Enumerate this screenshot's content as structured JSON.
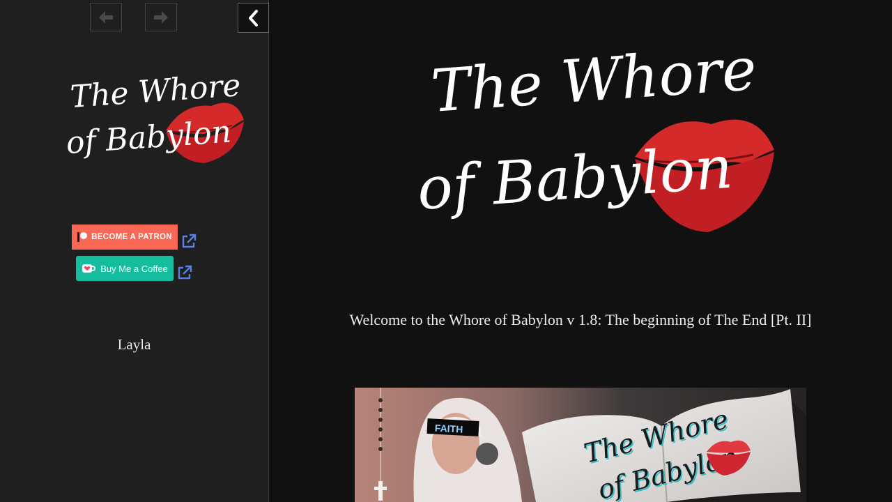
{
  "nav": {
    "back_icon": "arrow-left-icon",
    "forward_icon": "arrow-right-icon",
    "collapse_icon": "chevron-left-icon"
  },
  "sidebar": {
    "logo_text_line1": "The Whore",
    "logo_text_line2": "of Babylon",
    "patron_label": "BECOME A PATRON",
    "coffee_label": "Buy Me a Coffee",
    "external_link_icon": "external-link-icon",
    "author": "Layla"
  },
  "main": {
    "logo_text_line1": "The Whore",
    "logo_text_line2": "of Babylon",
    "welcome": "Welcome to the Whore of Babylon v 1.8: The beginning of The End [Pt. II]",
    "cover_badge": "FAITH",
    "cover_title_line1": "The Whore",
    "cover_title_line2": "of Babylon"
  },
  "colors": {
    "background": "#111111",
    "sidebar_bg": "#1f1f1f",
    "patron": "#f96854",
    "coffee": "#13bd9d",
    "link_icon": "#5b7fe0",
    "lips": "#d42a2a"
  }
}
